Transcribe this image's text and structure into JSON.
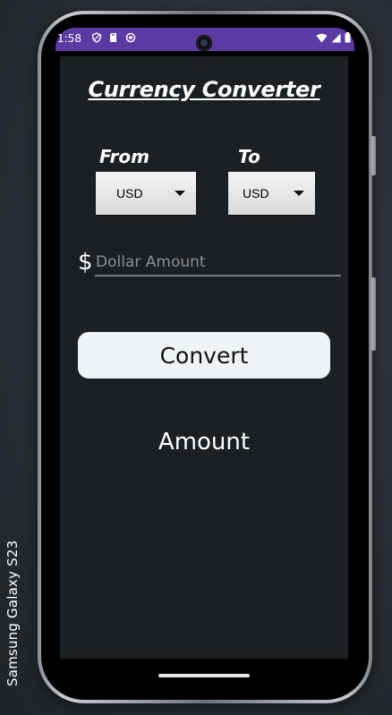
{
  "device": {
    "label": "Samsung Galaxy  S23"
  },
  "status_bar": {
    "time": "1:58",
    "left_icons": [
      "shield-icon",
      "sd-card-icon",
      "circle-status-icon"
    ],
    "right_icons": [
      "wifi-icon",
      "cell-signal-icon",
      "battery-icon"
    ],
    "color": "#5b3ba3"
  },
  "app": {
    "title": "Currency Converter",
    "from_label": "From",
    "to_label": "To",
    "from_currency": "USD",
    "to_currency": "USD",
    "currency_symbol": "$",
    "amount_placeholder": "Dollar Amount",
    "amount_value": "",
    "convert_label": "Convert",
    "result_text": "Amount"
  },
  "colors": {
    "screen_background": "#1b2025",
    "button_background": "#eef3f5",
    "spinner_background": "#e6e6e6"
  }
}
